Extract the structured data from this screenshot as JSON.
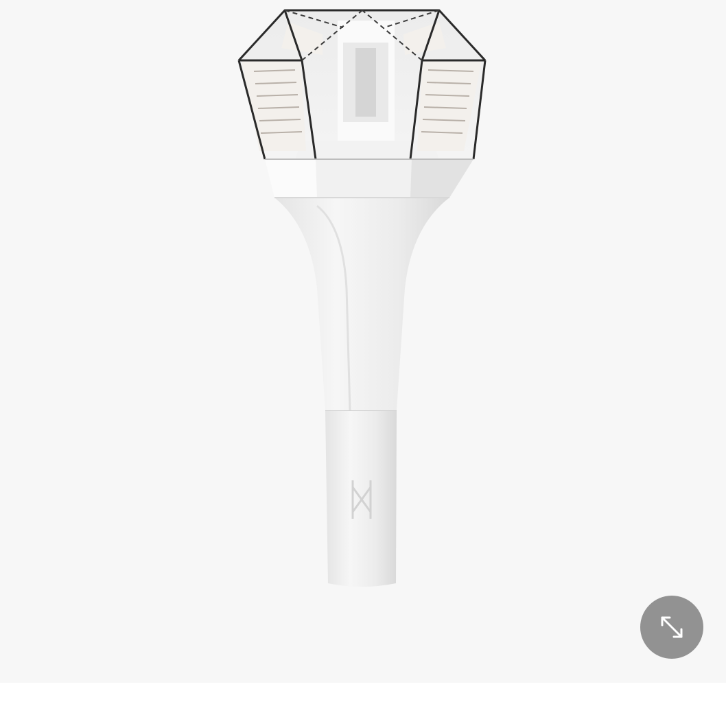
{
  "product": {
    "title": "",
    "image": {
      "subject": "lightstick",
      "colors": {
        "background": "#f7f7f7",
        "body": "#eeeeee",
        "body_shadow": "#dcdcdc",
        "crystal_frame": "#2a2a2a"
      }
    }
  },
  "controls": {
    "expand_icon": "expand-arrows-icon",
    "expand_button_color": "#8c8c8c"
  }
}
